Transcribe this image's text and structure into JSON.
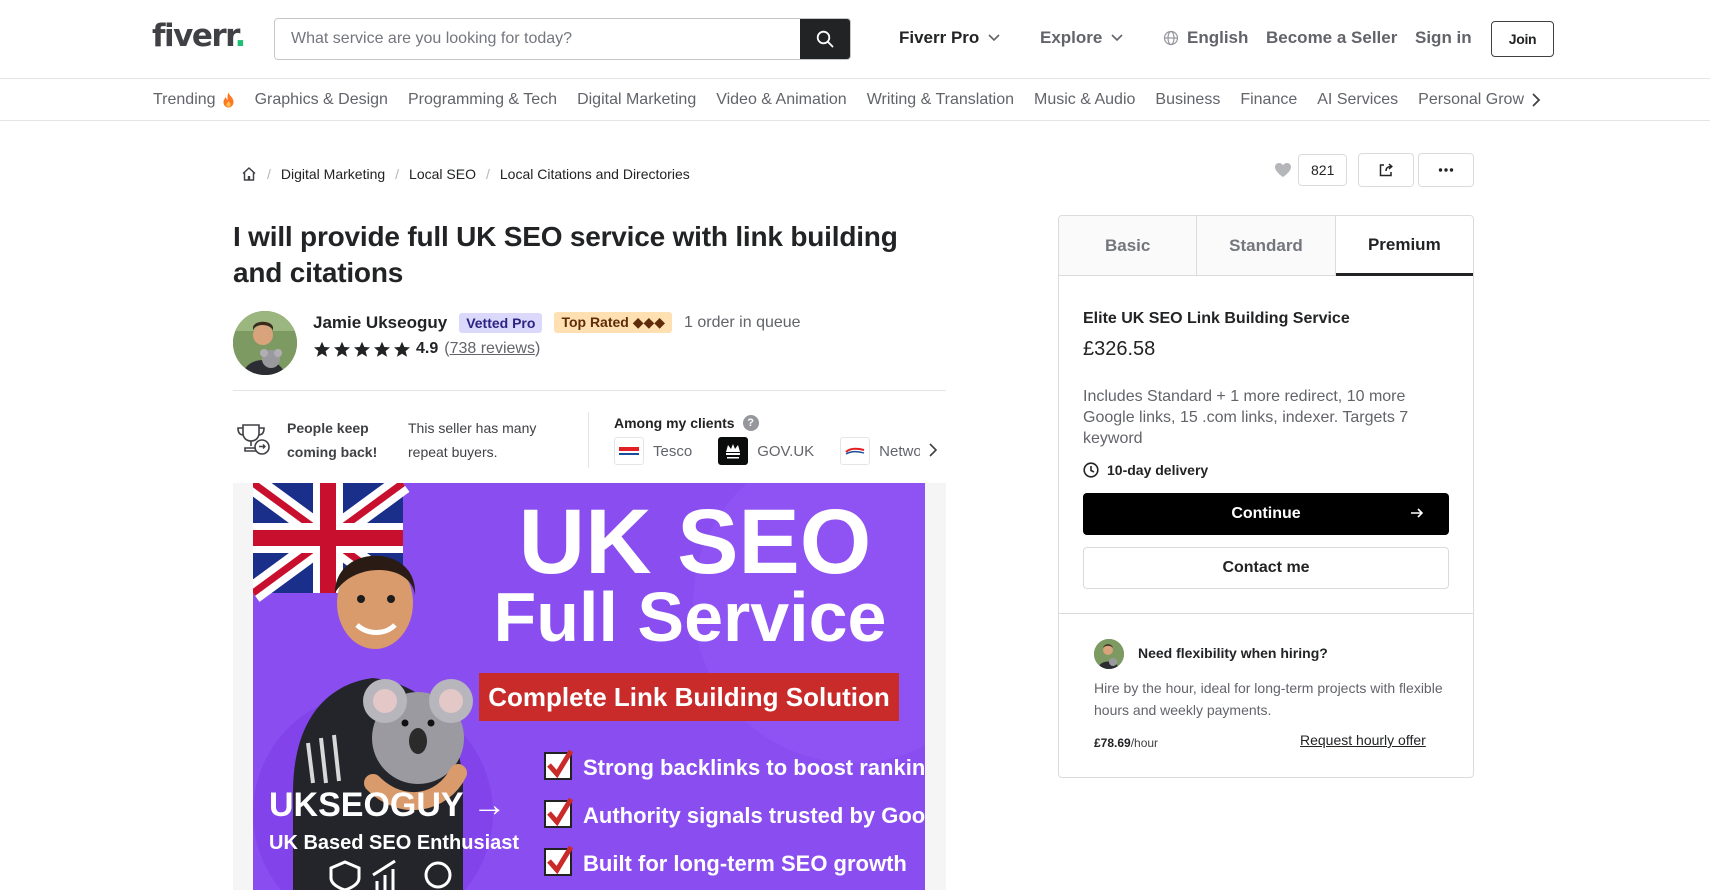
{
  "header": {
    "logo_text": "fiverr",
    "logo_dot": ".",
    "search_placeholder": "What service are you looking for today?",
    "nav": {
      "fiverr_pro": "Fiverr Pro",
      "explore": "Explore",
      "language": "English",
      "become_seller": "Become a Seller",
      "sign_in": "Sign in",
      "join": "Join"
    }
  },
  "categories": [
    "Trending",
    "Graphics & Design",
    "Programming & Tech",
    "Digital Marketing",
    "Video & Animation",
    "Writing & Translation",
    "Music & Audio",
    "Business",
    "Finance",
    "AI Services",
    "Personal Growth"
  ],
  "breadcrumb": {
    "items": [
      "Digital Marketing",
      "Local SEO",
      "Local Citations and Directories"
    ],
    "separator": "/"
  },
  "actions": {
    "favorites_count": "821"
  },
  "gig": {
    "title": "I will provide full UK SEO service with link building and citations"
  },
  "seller": {
    "name": "Jamie Ukseoguy",
    "badge_vetted": "Vetted Pro",
    "badge_top": "Top Rated ◆◆◆",
    "queue": "1 order in queue",
    "rating": "4.9",
    "stars": 5,
    "reviews_open": "(",
    "reviews": "738 reviews",
    "reviews_close": ")"
  },
  "repeat": {
    "title": "People keep coming back!",
    "text": "This seller has many repeat buyers."
  },
  "clients": {
    "title": "Among my clients",
    "help": "?",
    "items": [
      "Tesco",
      "GOV.UK",
      "Network Rail"
    ]
  },
  "gig_image": {
    "headline_1": "UK SEO",
    "headline_2": "Full Service",
    "banner": "Complete Link Building Solution",
    "brand": "UKSEOGUY →",
    "tagline": "UK Based SEO Enthusiast",
    "checks": [
      "Strong backlinks to boost rankings",
      "Authority signals trusted by Google",
      "Built for long-term SEO growth"
    ],
    "colors": {
      "background": "#8a4df0",
      "banner": "#c92a2a",
      "text": "#ffffff"
    }
  },
  "pricing": {
    "tabs": [
      "Basic",
      "Standard",
      "Premium"
    ],
    "active_tab": "Premium",
    "package_title": "Elite UK SEO Link Building Service",
    "price": "£326.58",
    "description": "Includes Standard + 1 more redirect, 10 more Google links, 15 .com links, indexer. Targets 7 keyword",
    "delivery": "10-day delivery",
    "continue": "Continue",
    "contact": "Contact me"
  },
  "hourly": {
    "title": "Need flexibility when hiring?",
    "description": "Hire by the hour, ideal for long-term projects with flexible hours and weekly payments.",
    "rate": "£78.69",
    "rate_unit": "/hour",
    "link": "Request hourly offer"
  },
  "colors": {
    "brand_green": "#1dbf73",
    "text_dark": "#222325",
    "text_muted": "#62646a",
    "border": "#dadbdd"
  }
}
